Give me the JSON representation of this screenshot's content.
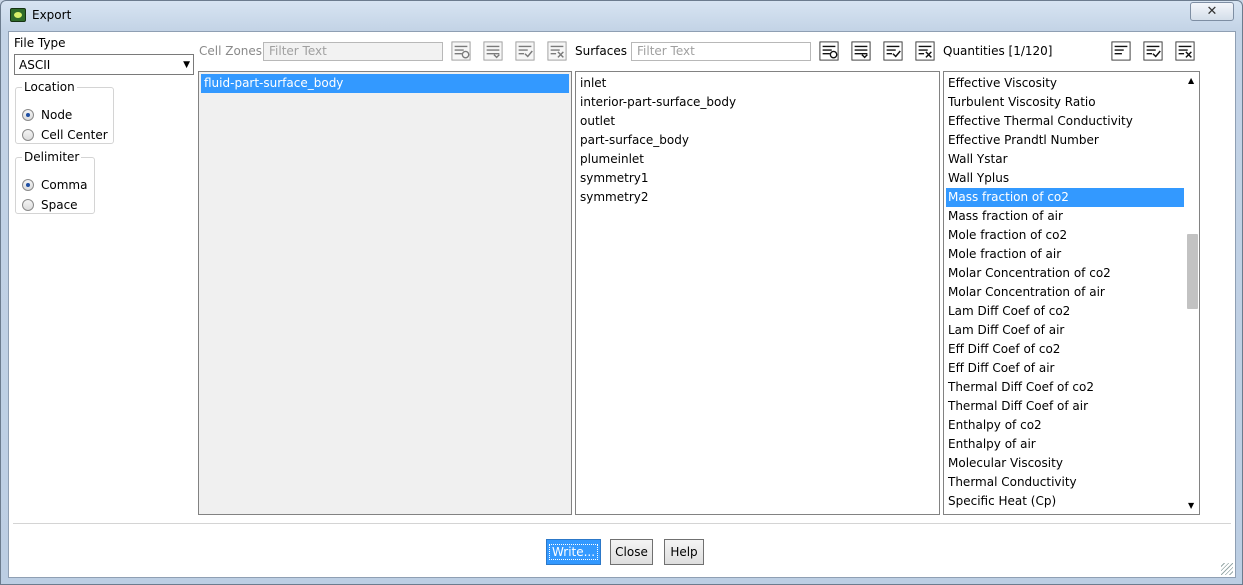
{
  "window": {
    "title": "Export"
  },
  "file_type": {
    "label": "File Type",
    "value": "ASCII"
  },
  "location": {
    "label": "Location",
    "options": [
      {
        "label": "Node",
        "checked": true
      },
      {
        "label": "Cell Center",
        "checked": false
      }
    ]
  },
  "delimiter": {
    "label": "Delimiter",
    "options": [
      {
        "label": "Comma",
        "checked": true
      },
      {
        "label": "Space",
        "checked": false
      }
    ]
  },
  "cell_zones": {
    "label": "Cell Zones",
    "filter_placeholder": "Filter Text",
    "items": [
      {
        "label": "fluid-part-surface_body",
        "selected": true
      }
    ]
  },
  "surfaces": {
    "label": "Surfaces",
    "filter_placeholder": "Filter Text",
    "items": [
      {
        "label": "inlet"
      },
      {
        "label": "interior-part-surface_body"
      },
      {
        "label": "outlet"
      },
      {
        "label": "part-surface_body"
      },
      {
        "label": "plumeinlet"
      },
      {
        "label": "symmetry1"
      },
      {
        "label": "symmetry2"
      }
    ]
  },
  "quantities": {
    "label": "Quantities [1/120]",
    "items": [
      {
        "label": "Effective Viscosity"
      },
      {
        "label": "Turbulent Viscosity Ratio"
      },
      {
        "label": "Effective Thermal Conductivity"
      },
      {
        "label": "Effective Prandtl Number"
      },
      {
        "label": "Wall Ystar"
      },
      {
        "label": "Wall Yplus"
      },
      {
        "label": "Mass fraction of co2",
        "selected": true
      },
      {
        "label": "Mass fraction of air"
      },
      {
        "label": "Mole fraction of co2"
      },
      {
        "label": "Mole fraction of air"
      },
      {
        "label": "Molar Concentration of co2"
      },
      {
        "label": "Molar Concentration of air"
      },
      {
        "label": "Lam Diff Coef of co2"
      },
      {
        "label": "Lam Diff Coef of air"
      },
      {
        "label": "Eff Diff Coef of co2"
      },
      {
        "label": "Eff Diff Coef of air"
      },
      {
        "label": "Thermal Diff Coef of co2"
      },
      {
        "label": "Thermal Diff Coef of air"
      },
      {
        "label": "Enthalpy of co2"
      },
      {
        "label": "Enthalpy of air"
      },
      {
        "label": "Molecular Viscosity"
      },
      {
        "label": "Thermal Conductivity"
      },
      {
        "label": "Specific Heat (Cp)"
      }
    ]
  },
  "buttons": {
    "write": "Write...",
    "close": "Close",
    "help": "Help"
  },
  "colors": {
    "selection": "#3399ff",
    "title_bar": "#c8d8ec"
  }
}
